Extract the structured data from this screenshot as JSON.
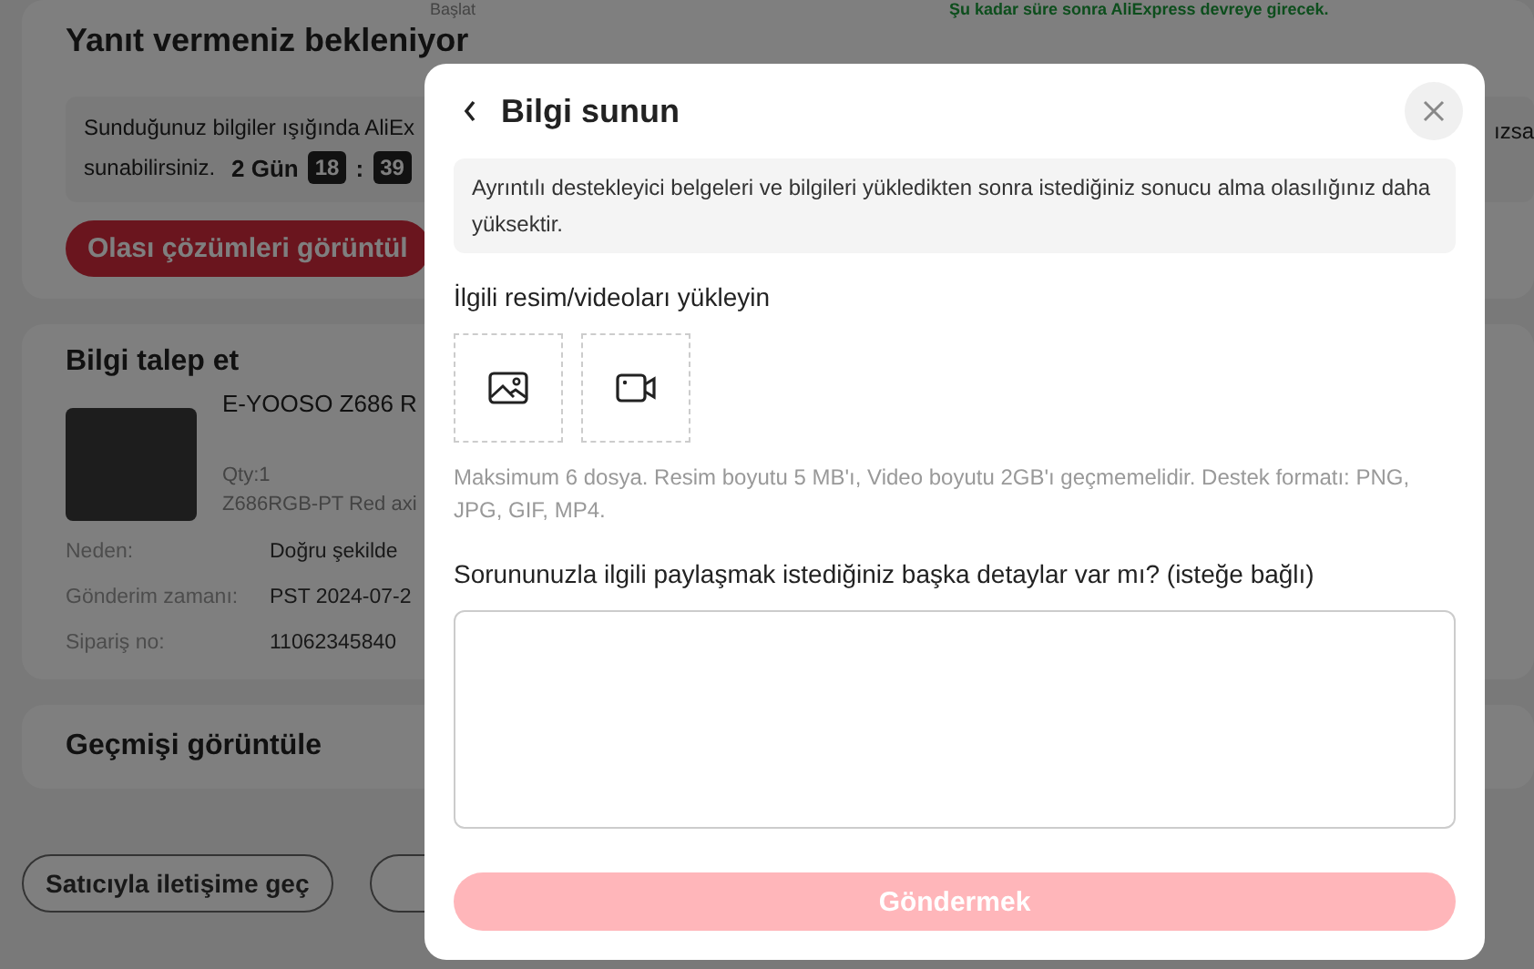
{
  "page": {
    "top_left": "Başlat",
    "top_notice": "Şu kadar süre sonra AliExpress devreye girecek.",
    "awaiting": {
      "title": "Yanıt vermeniz bekleniyor",
      "info_text": "Sunduğunuz bilgiler ışığında AliEx",
      "info_text_right": "ızsa",
      "timer_prefix": "sunabilirsiniz.",
      "days": "2 Gün",
      "hours": "18",
      "separator": ":",
      "minutes": "39",
      "button": "Olası çözümleri görüntül"
    },
    "request": {
      "title": "Bilgi talep et",
      "product_name": "E-YOOSO Z686 R",
      "qty": "Qty:1",
      "variant": "Z686RGB-PT Red axi",
      "details": [
        {
          "label": "Neden:",
          "value": "Doğru şekilde"
        },
        {
          "label": "Gönderim zamanı:",
          "value": "PST 2024-07-2"
        },
        {
          "label": "Sipariş no:",
          "value": "11062345840"
        }
      ]
    },
    "history": {
      "title": "Geçmişi görüntüle"
    },
    "actions": [
      "Satıcıyla iletişime geç"
    ]
  },
  "dialog": {
    "title": "Bilgi sunun",
    "notice": "Ayrıntılı destekleyici belgeleri ve bilgileri yükledikten sonra istediğiniz sonucu alma olasılığınız daha yüksektir.",
    "upload_label": "İlgili resim/videoları yükleyin",
    "upload_slots": [
      {
        "kind": "image"
      },
      {
        "kind": "video"
      }
    ],
    "upload_hint": "Maksimum 6 dosya. Resim boyutu 5 MB'ı, Video boyutu 2GB'ı geçmemelidir. Destek formatı: PNG, JPG, GIF, MP4.",
    "details_label": "Sorununuzla ilgili paylaşmak istediğiniz başka detaylar var mı? (isteğe bağlı)",
    "submit": {
      "label": "Göndermek",
      "disabled": true
    }
  }
}
